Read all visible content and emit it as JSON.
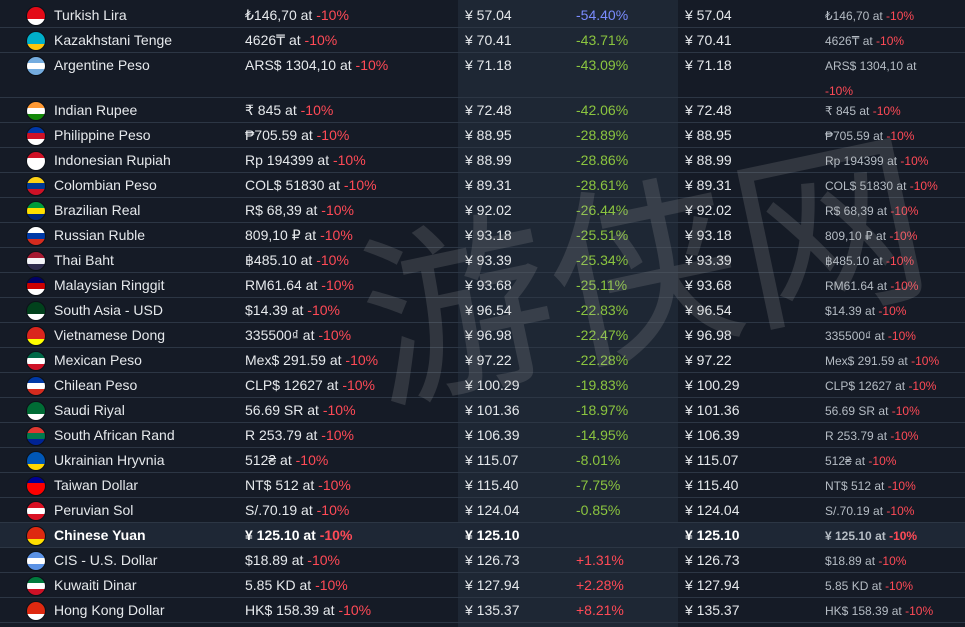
{
  "rows": [
    {
      "name": "Turkish Lira",
      "price": "₺146,70",
      "discount_text": "at",
      "discount": "-10%",
      "usd": "¥ 57.04",
      "pct": "-54.40%",
      "pct_color": "blue",
      "usd2": "¥ 57.04",
      "price2": "₺146,70",
      "discount2": "-10%",
      "flag": [
        "#e30a17",
        "#e30a17",
        "#ffffff"
      ]
    },
    {
      "name": "Kazakhstani Tenge",
      "price": "4626₸",
      "discount_text": "at",
      "discount": "-10%",
      "usd": "¥ 70.41",
      "pct": "-43.71%",
      "pct_color": "green",
      "usd2": "¥ 70.41",
      "price2": "4626₸",
      "discount2": "-10%",
      "flag": [
        "#00afca",
        "#00afca",
        "#fec50c"
      ]
    },
    {
      "name": "Argentine Peso",
      "price": "ARS$ 1304,10",
      "discount_text": "at",
      "discount": "-10%",
      "usd": "¥ 71.18",
      "pct": "-43.09%",
      "pct_color": "green",
      "usd2": "¥ 71.18",
      "price2": "ARS$ 1304,10",
      "discount2": "-10%",
      "tall": true,
      "flag": [
        "#74acdf",
        "#ffffff",
        "#74acdf"
      ]
    },
    {
      "name": "Indian Rupee",
      "price": "₹ 845",
      "discount_text": "at",
      "discount": "-10%",
      "usd": "¥ 72.48",
      "pct": "-42.06%",
      "pct_color": "green",
      "usd2": "¥ 72.48",
      "price2": "₹ 845",
      "discount2": "-10%",
      "flag": [
        "#ff9933",
        "#ffffff",
        "#138808"
      ]
    },
    {
      "name": "Philippine Peso",
      "price": "₱705.59",
      "discount_text": "at",
      "discount": "-10%",
      "usd": "¥ 88.95",
      "pct": "-28.89%",
      "pct_color": "green",
      "usd2": "¥ 88.95",
      "price2": "₱705.59",
      "discount2": "-10%",
      "flag": [
        "#0038a8",
        "#ce1126",
        "#ffffff"
      ]
    },
    {
      "name": "Indonesian Rupiah",
      "price": "Rp 194399",
      "discount_text": "at",
      "discount": "-10%",
      "usd": "¥ 88.99",
      "pct": "-28.86%",
      "pct_color": "green",
      "usd2": "¥ 88.99",
      "price2": "Rp 194399",
      "discount2": "-10%",
      "flag": [
        "#ce1126",
        "#ffffff",
        "#ffffff"
      ]
    },
    {
      "name": "Colombian Peso",
      "price": "COL$ 51830",
      "discount_text": "at",
      "discount": "-10%",
      "usd": "¥ 89.31",
      "pct": "-28.61%",
      "pct_color": "green",
      "usd2": "¥ 89.31",
      "price2": "COL$ 51830",
      "discount2": "-10%",
      "flag": [
        "#fcd116",
        "#003893",
        "#ce1126"
      ]
    },
    {
      "name": "Brazilian Real",
      "price": "R$ 68,39",
      "discount_text": "at",
      "discount": "-10%",
      "usd": "¥ 92.02",
      "pct": "-26.44%",
      "pct_color": "green",
      "usd2": "¥ 92.02",
      "price2": "R$ 68,39",
      "discount2": "-10%",
      "flag": [
        "#009c3b",
        "#ffdf00",
        "#002776"
      ]
    },
    {
      "name": "Russian Ruble",
      "price": "809,10 ₽",
      "discount_text": "at",
      "discount": "-10%",
      "usd": "¥ 93.18",
      "pct": "-25.51%",
      "pct_color": "green",
      "usd2": "¥ 93.18",
      "price2": "809,10 ₽",
      "discount2": "-10%",
      "flag": [
        "#ffffff",
        "#0039a6",
        "#d52b1e"
      ]
    },
    {
      "name": "Thai Baht",
      "price": "฿485.10",
      "discount_text": "at",
      "discount": "-10%",
      "usd": "¥ 93.39",
      "pct": "-25.34%",
      "pct_color": "green",
      "usd2": "¥ 93.39",
      "price2": "฿485.10",
      "discount2": "-10%",
      "flag": [
        "#a51931",
        "#f4f5f8",
        "#2d2a4a"
      ]
    },
    {
      "name": "Malaysian Ringgit",
      "price": "RM61.64",
      "discount_text": "at",
      "discount": "-10%",
      "usd": "¥ 93.68",
      "pct": "-25.11%",
      "pct_color": "green",
      "usd2": "¥ 93.68",
      "price2": "RM61.64",
      "discount2": "-10%",
      "flag": [
        "#010066",
        "#cc0001",
        "#ffffff"
      ]
    },
    {
      "name": "South Asia - USD",
      "price": "$14.39",
      "discount_text": "at",
      "discount": "-10%",
      "usd": "¥ 96.54",
      "pct": "-22.83%",
      "pct_color": "green",
      "usd2": "¥ 96.54",
      "price2": "$14.39",
      "discount2": "-10%",
      "flag": [
        "#01411c",
        "#01411c",
        "#ffffff"
      ]
    },
    {
      "name": "Vietnamese Dong",
      "price": "335500₫",
      "discount_text": "at",
      "discount": "-10%",
      "usd": "¥ 96.98",
      "pct": "-22.47%",
      "pct_color": "green",
      "usd2": "¥ 96.98",
      "price2": "335500₫",
      "discount2": "-10%",
      "flag": [
        "#da251d",
        "#da251d",
        "#ffff00"
      ]
    },
    {
      "name": "Mexican Peso",
      "price": "Mex$ 291.59",
      "discount_text": "at",
      "discount": "-10%",
      "usd": "¥ 97.22",
      "pct": "-22.28%",
      "pct_color": "green",
      "usd2": "¥ 97.22",
      "price2": "Mex$ 291.59",
      "discount2": "-10%",
      "flag": [
        "#006847",
        "#ffffff",
        "#ce1126"
      ]
    },
    {
      "name": "Chilean Peso",
      "price": "CLP$ 12627",
      "discount_text": "at",
      "discount": "-10%",
      "usd": "¥ 100.29",
      "pct": "-19.83%",
      "pct_color": "green",
      "usd2": "¥ 100.29",
      "price2": "CLP$ 12627",
      "discount2": "-10%",
      "flag": [
        "#0039a6",
        "#ffffff",
        "#d52b1e"
      ]
    },
    {
      "name": "Saudi Riyal",
      "price": "56.69 SR",
      "discount_text": "at",
      "discount": "-10%",
      "usd": "¥ 101.36",
      "pct": "-18.97%",
      "pct_color": "green",
      "usd2": "¥ 101.36",
      "price2": "56.69 SR",
      "discount2": "-10%",
      "flag": [
        "#006c35",
        "#006c35",
        "#ffffff"
      ]
    },
    {
      "name": "South African Rand",
      "price": "R 253.79",
      "discount_text": "at",
      "discount": "-10%",
      "usd": "¥ 106.39",
      "pct": "-14.95%",
      "pct_color": "green",
      "usd2": "¥ 106.39",
      "price2": "R 253.79",
      "discount2": "-10%",
      "flag": [
        "#de3831",
        "#007a4d",
        "#002395"
      ]
    },
    {
      "name": "Ukrainian Hryvnia",
      "price": "512₴",
      "discount_text": "at",
      "discount": "-10%",
      "usd": "¥ 115.07",
      "pct": "-8.01%",
      "pct_color": "green",
      "usd2": "¥ 115.07",
      "price2": "512₴",
      "discount2": "-10%",
      "flag": [
        "#0057b7",
        "#0057b7",
        "#ffd700"
      ]
    },
    {
      "name": "Taiwan Dollar",
      "price": "NT$ 512",
      "discount_text": "at",
      "discount": "-10%",
      "usd": "¥ 115.40",
      "pct": "-7.75%",
      "pct_color": "green",
      "usd2": "¥ 115.40",
      "price2": "NT$ 512",
      "discount2": "-10%",
      "flag": [
        "#000095",
        "#fe0000",
        "#fe0000"
      ]
    },
    {
      "name": "Peruvian Sol",
      "price": "S/.70.19",
      "discount_text": "at",
      "discount": "-10%",
      "usd": "¥ 124.04",
      "pct": "-0.85%",
      "pct_color": "green",
      "usd2": "¥ 124.04",
      "price2": "S/.70.19",
      "discount2": "-10%",
      "flag": [
        "#d91023",
        "#ffffff",
        "#d91023"
      ]
    },
    {
      "name": "Chinese Yuan",
      "price": "¥ 125.10",
      "discount_text": "at",
      "discount": "-10%",
      "usd": "¥ 125.10",
      "pct": "",
      "pct_color": "green",
      "usd2": "¥ 125.10",
      "price2": "¥ 125.10",
      "discount2": "-10%",
      "bold": true,
      "flag": [
        "#de2910",
        "#de2910",
        "#ffde00"
      ]
    },
    {
      "name": "CIS - U.S. Dollar",
      "price": "$18.89",
      "discount_text": "at",
      "discount": "-10%",
      "usd": "¥ 126.73",
      "pct": "+1.31%",
      "pct_color": "red",
      "usd2": "¥ 126.73",
      "price2": "$18.89",
      "discount2": "-10%",
      "flag": [
        "#5b92e5",
        "#ffffff",
        "#5b92e5"
      ]
    },
    {
      "name": "Kuwaiti Dinar",
      "price": "5.85 KD",
      "discount_text": "at",
      "discount": "-10%",
      "usd": "¥ 127.94",
      "pct": "+2.28%",
      "pct_color": "red",
      "usd2": "¥ 127.94",
      "price2": "5.85 KD",
      "discount2": "-10%",
      "flag": [
        "#007a3d",
        "#ffffff",
        "#ce1126"
      ]
    },
    {
      "name": "Hong Kong Dollar",
      "price": "HK$ 158.39",
      "discount_text": "at",
      "discount": "-10%",
      "usd": "¥ 135.37",
      "pct": "+8.21%",
      "pct_color": "red",
      "usd2": "¥ 135.37",
      "price2": "HK$ 158.39",
      "discount2": "-10%",
      "flag": [
        "#de2910",
        "#de2910",
        "#ffffff"
      ]
    }
  ]
}
